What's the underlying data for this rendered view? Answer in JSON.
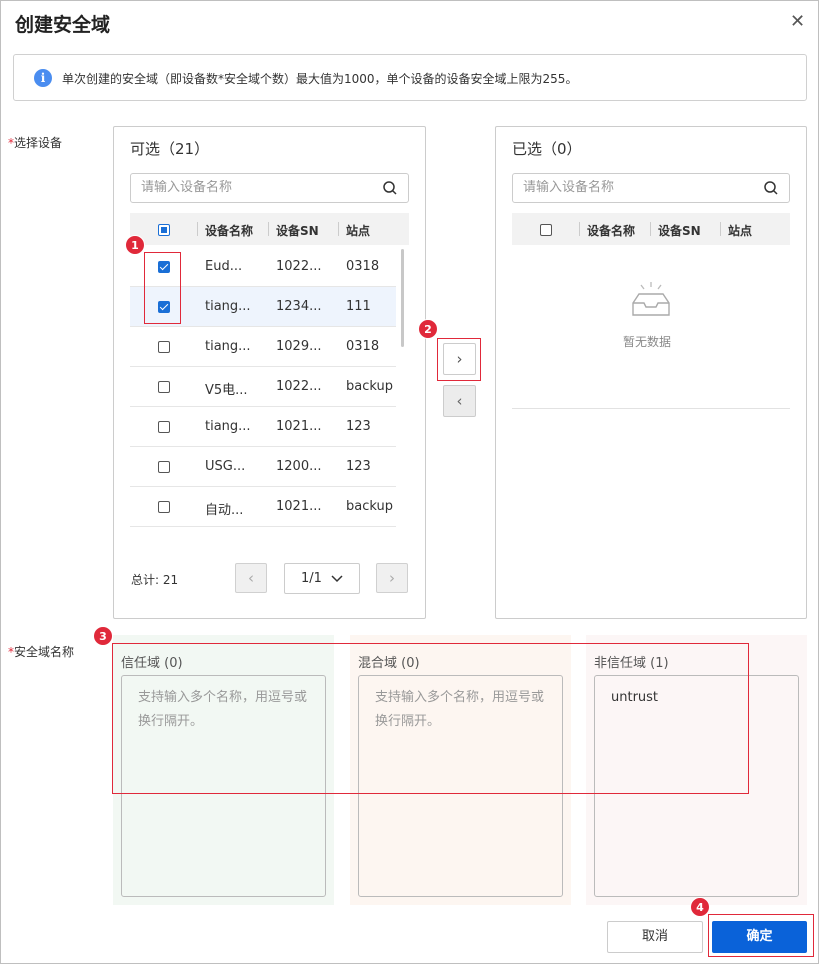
{
  "dialog": {
    "title": "创建安全域",
    "info": "单次创建的安全域（即设备数*安全域个数）最大值为1000，单个设备的设备安全域上限为255。",
    "label_devices": "选择设备",
    "label_zones": "安全域名称",
    "cancel_label": "取消",
    "ok_label": "确定"
  },
  "available": {
    "title": "可选（21）",
    "search_placeholder": "请输入设备名称",
    "columns": [
      "设备名称",
      "设备SN",
      "站点"
    ],
    "rows": [
      {
        "name": "Eud...",
        "sn": "1022...",
        "site": "0318",
        "checked": true
      },
      {
        "name": "tiang...",
        "sn": "1234...",
        "site": "111",
        "checked": true
      },
      {
        "name": "tiang...",
        "sn": "1029...",
        "site": "0318",
        "checked": false
      },
      {
        "name": "V5电...",
        "sn": "1022...",
        "site": "backup",
        "checked": false
      },
      {
        "name": "tiang...",
        "sn": "1021...",
        "site": "123",
        "checked": false
      },
      {
        "name": "USG...",
        "sn": "1200...",
        "site": "123",
        "checked": false
      },
      {
        "name": "自动...",
        "sn": "1021...",
        "site": "backup",
        "checked": false
      }
    ],
    "total": "总计: 21",
    "page": "1/1"
  },
  "selected": {
    "title": "已选（0）",
    "search_placeholder": "请输入设备名称",
    "columns": [
      "设备名称",
      "设备SN",
      "站点"
    ],
    "empty": "暂无数据"
  },
  "zones": [
    {
      "title": "信任域 (0)",
      "placeholder": "支持输入多个名称，用逗号或换行隔开。",
      "value": "",
      "bg": "#f2f8f3"
    },
    {
      "title": "混合域 (0)",
      "placeholder": "支持输入多个名称，用逗号或换行隔开。",
      "value": "",
      "bg": "#fdf6f1"
    },
    {
      "title": "非信任域 (1)",
      "placeholder": "",
      "value": "untrust",
      "bg": "#fcf6f6"
    }
  ],
  "badges": [
    "1",
    "2",
    "3",
    "4"
  ],
  "colors": {
    "primary": "#0a62d9",
    "highlight": "#e0293a",
    "info": "#4a8df0"
  }
}
